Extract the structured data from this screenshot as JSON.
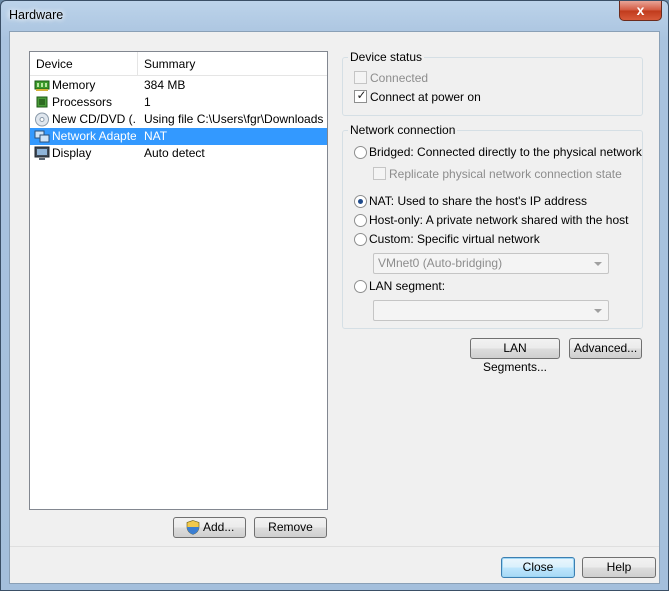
{
  "window": {
    "title": "Hardware",
    "close_glyph": "x"
  },
  "list": {
    "headers": [
      "Device",
      "Summary"
    ],
    "rows": [
      {
        "device": "Memory",
        "summary": "384 MB",
        "icon": "memory-icon"
      },
      {
        "device": "Processors",
        "summary": "1",
        "icon": "processor-icon"
      },
      {
        "device": "New CD/DVD (...",
        "summary": "Using file C:\\Users\\fgr\\Downloads...",
        "icon": "cd-dvd-icon"
      },
      {
        "device": "Network Adapter",
        "summary": "NAT",
        "icon": "network-adapter-icon",
        "selected": true
      },
      {
        "device": "Display",
        "summary": "Auto detect",
        "icon": "display-icon"
      }
    ]
  },
  "buttons": {
    "add": "Add...",
    "remove": "Remove",
    "lan_segments": "LAN Segments...",
    "advanced": "Advanced...",
    "close": "Close",
    "help": "Help"
  },
  "device_status": {
    "label": "Device status",
    "connected": {
      "label": "Connected",
      "checked": false,
      "disabled": true
    },
    "connect_at_power_on": {
      "label": "Connect at power on",
      "checked": true
    }
  },
  "network_connection": {
    "label": "Network connection",
    "options": [
      {
        "label": "Bridged: Connected directly to the physical network",
        "selected": false
      },
      {
        "label": "NAT: Used to share the host's IP address",
        "selected": true
      },
      {
        "label": "Host-only: A private network shared with the host",
        "selected": false
      },
      {
        "label": "Custom: Specific virtual network",
        "selected": false
      },
      {
        "label": "LAN segment:",
        "selected": false
      }
    ],
    "replicate": {
      "label": "Replicate physical network connection state",
      "checked": false,
      "disabled": true
    },
    "custom_value": "VMnet0 (Auto-bridging)",
    "lan_segment_value": ""
  },
  "colors": {
    "selection": "#3399ff",
    "dialog_bg": "#f0f0f0",
    "title_gradient": "#bcd3ea",
    "close_red": "#c03a1c"
  }
}
